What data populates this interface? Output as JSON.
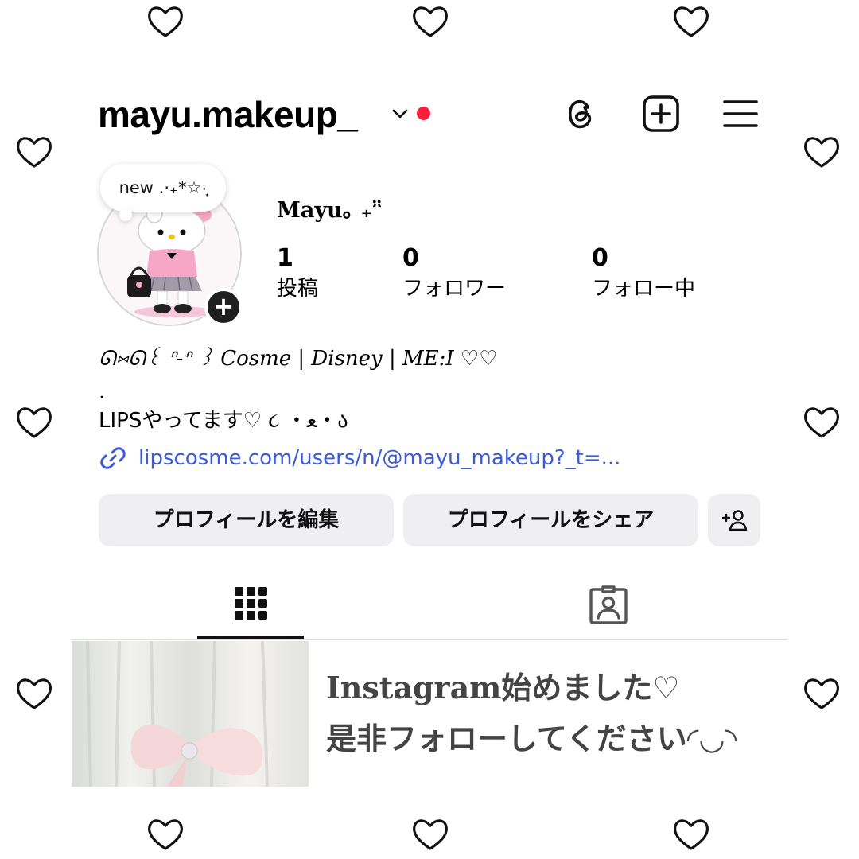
{
  "profile": {
    "username": "mayu.makeup_",
    "note": "new .·₊*☆·̩͙",
    "display_name": "Mayu｡ ₊ᵔ̈",
    "stats": [
      {
        "value": "1",
        "label": "投稿"
      },
      {
        "value": "0",
        "label": "フォロワー"
      },
      {
        "value": "0",
        "label": "フォロー中"
      }
    ],
    "bio_line_1": "ᘏ⑅ᘏ꒰ ᐢ-ᐢ ꒱ Cosme | Disney | ME:I ♡♡",
    "bio_dot": ".",
    "bio_line_2": "LIPSやってます♡ ૮ ・ﻌ・ა",
    "link": "lipscosme.com/users/n/@mayu_makeup?_t=..."
  },
  "buttons": {
    "edit_profile": "プロフィールを編集",
    "share_profile": "プロフィールをシェア"
  },
  "post_caption": {
    "line_1": "Instagram始めました♡",
    "line_2": "是非フォローしてください◜◡◝"
  },
  "icons": {
    "header": [
      "threads-icon",
      "add-post-icon",
      "menu-icon"
    ],
    "tabs": [
      "grid-icon",
      "tagged-icon"
    ],
    "link": "link-icon",
    "discover_people": "add-person-icon",
    "decorations": "heart-outline-icon"
  },
  "colors": {
    "notification_dot": "#ff1f3d",
    "link": "#3b5bdb",
    "button_bg": "#efeff2",
    "caption": "#444444"
  }
}
